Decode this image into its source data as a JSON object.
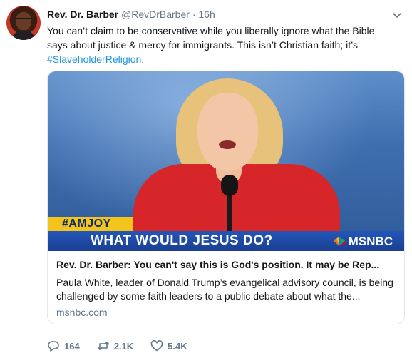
{
  "tweet": {
    "name": "Rev. Dr. Barber",
    "handle": "@RevDrBarber",
    "separator": "·",
    "time": "16h",
    "text_main": "You can’t claim to be conservative while you liberally ignore what the Bible says about justice & mercy for immigrants. This isn’t Christian faith; it’s",
    "hashtag": "#SlaveholderReligion",
    "text_end": "."
  },
  "card": {
    "overlay_tag": "#AMJOY",
    "overlay_banner": "WHAT WOULD JESUS DO?",
    "network": "MSNBC",
    "title": "Rev. Dr. Barber: You can't say this is God's position. It may be Rep...",
    "description": "Paula White, leader of Donald Trump’s evangelical advisory council, is being challenged by some faith leaders to a public debate about what the...",
    "domain": "msnbc.com"
  },
  "actions": {
    "replies": "164",
    "retweets": "2.1K",
    "likes": "5.4K"
  },
  "colors": {
    "link": "#1b95e0",
    "secondary": "#657786",
    "border": "#e1e8ed"
  },
  "icons": {
    "reply": "reply-icon",
    "retweet": "retweet-icon",
    "like": "heart-icon",
    "menu": "chevron-down-icon"
  }
}
